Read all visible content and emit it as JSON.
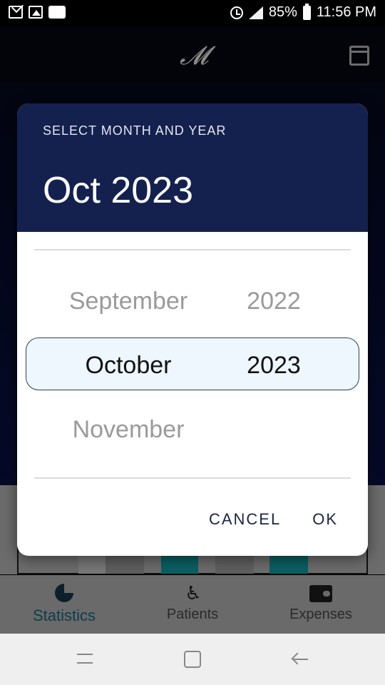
{
  "status_bar": {
    "battery": "85%",
    "time": "11:56 PM",
    "icons": [
      "mail-icon",
      "image-icon",
      "video-icon",
      "alarm-icon",
      "signal-icon",
      "battery-icon"
    ]
  },
  "app": {
    "logo_icon": "m-logo",
    "calendar_icon": "calendar-icon"
  },
  "dialog": {
    "overline": "SELECT MONTH AND YEAR",
    "title": "Oct 2023",
    "picker": {
      "months": [
        "September",
        "October",
        "November"
      ],
      "years": [
        "2022",
        "2023"
      ],
      "selected_month": "October",
      "selected_year": "2023"
    },
    "cancel_label": "CANCEL",
    "ok_label": "OK"
  },
  "bottom_nav": {
    "items": [
      {
        "label": "Statistics",
        "icon": "pie-chart-icon",
        "active": true
      },
      {
        "label": "Patients",
        "icon": "wheelchair-icon",
        "active": false
      },
      {
        "label": "Expenses",
        "icon": "wallet-icon",
        "active": false
      }
    ]
  },
  "colors": {
    "dialog_header": "#14214e",
    "accent_teal": "#0b5f62",
    "selection_bg": "#eef7fd"
  }
}
